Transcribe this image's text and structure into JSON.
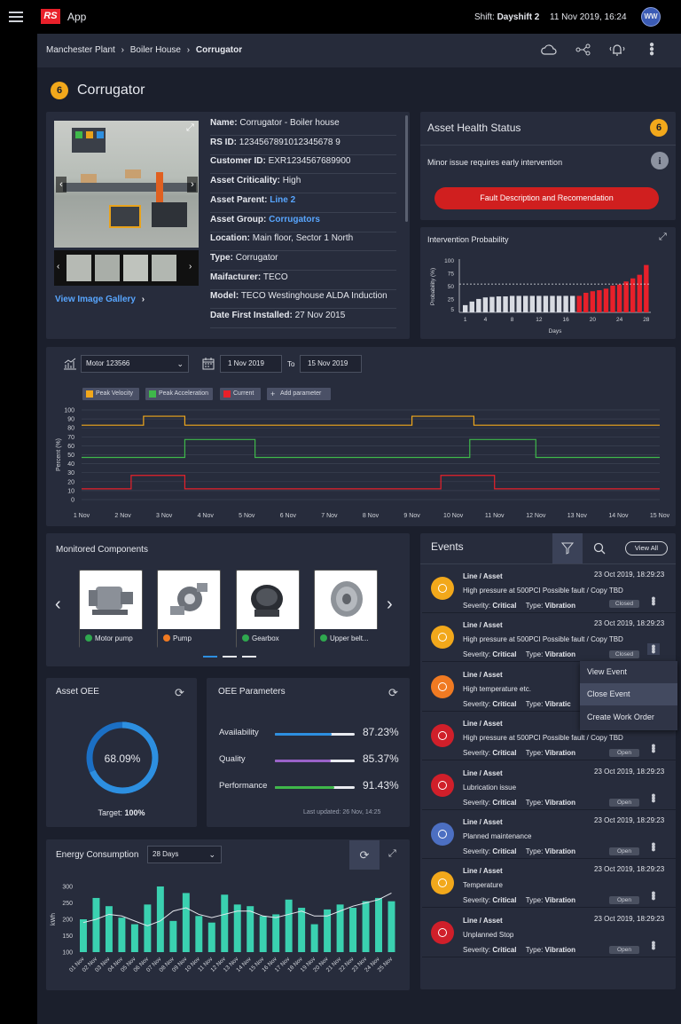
{
  "app": {
    "logo": "RS",
    "name": "App",
    "shift_label": "Shift:",
    "shift_value": "Dayshift 2",
    "datetime": "11 Nov 2019, 16:24",
    "user_initials": "WW"
  },
  "breadcrumb": {
    "items": [
      "Manchester Plant",
      "Boiler House"
    ],
    "current": "Corrugator"
  },
  "asset": {
    "badge": "6",
    "title": "Corrugator",
    "view_gallery": "View Image Gallery",
    "fields": [
      {
        "label": "Name:",
        "value": "Corrugator - Boiler house"
      },
      {
        "label": "RS ID:",
        "value": "1234567891012345678 9"
      },
      {
        "label": "Customer ID:",
        "value": "EXR1234567689900"
      },
      {
        "label": "Asset Criticality:",
        "value": "High"
      },
      {
        "label": "Asset Parent:",
        "value": "Line 2"
      },
      {
        "label": "Asset Group:",
        "value": "Corrugators"
      },
      {
        "label": "Location:",
        "value": "Main floor, Sector 1 North"
      },
      {
        "label": "Type:",
        "value": "Corrugator"
      },
      {
        "label": "Maifacturer:",
        "value": "TECO"
      },
      {
        "label": "Model:",
        "value": "TECO Westinghouse ALDA Induction"
      },
      {
        "label": "Date First Installed:",
        "value": "27 Nov 2015"
      }
    ]
  },
  "health": {
    "title": "Asset Health Status",
    "badge": "6",
    "message": "Minor issue requires early intervention",
    "button": "Fault Description and Recomendation"
  },
  "intervention": {
    "title": "Intervention Probability"
  },
  "motor": {
    "select": "Motor 123566",
    "date_from": "1 Nov 2019",
    "to_label": "To",
    "date_to": "15 Nov 2019",
    "params": [
      "Peak Velocity",
      "Peak Acceleration",
      "Current",
      "Add parameter"
    ]
  },
  "components": {
    "title": "Monitored Components",
    "items": [
      {
        "label": "Motor pump",
        "status": "#2fa84f"
      },
      {
        "label": "Pump",
        "status": "#f07a22"
      },
      {
        "label": "Gearbox",
        "status": "#2fa84f"
      },
      {
        "label": "Upper belt...",
        "status": "#2fa84f"
      }
    ]
  },
  "oee": {
    "title": "Asset OEE",
    "value": "68.09%",
    "value_num": 68.09,
    "target_label": "Target:",
    "target_value": "100%"
  },
  "oee_params": {
    "title": "OEE Parameters",
    "updated": "Last updated: 26 Nov, 14:25",
    "rows": [
      {
        "label": "Availability",
        "value": "87.23%",
        "num": 87.23,
        "color": "#2d8fe0"
      },
      {
        "label": "Quality",
        "value": "85.37%",
        "num": 85.37,
        "color": "#9a62c9"
      },
      {
        "label": "Performance",
        "value": "91.43%",
        "num": 91.43,
        "color": "#3fb84a"
      }
    ]
  },
  "energy": {
    "title": "Energy Consumption",
    "select": "28 Days"
  },
  "events": {
    "title": "Events",
    "view_all": "View All",
    "menu": [
      "View Event",
      "Close Event",
      "Create Work Order"
    ],
    "items": [
      {
        "heading": "Line / Asset",
        "date": "23 Oct 2019, 18:29:23",
        "desc": "High pressure at 500PCI Possible fault / Copy TBD",
        "sev_label": "Severity:",
        "sev": "Critical",
        "type_label": "Type:",
        "type": "Vibration",
        "status": "Closed",
        "icon": "valve-icon",
        "color": "#f2a81b"
      },
      {
        "heading": "Line / Asset",
        "date": "23 Oct 2019, 18:29:23",
        "desc": "High pressure at 500PCI Possible fault / Copy TBD",
        "sev_label": "Severity:",
        "sev": "Critical",
        "type_label": "Type:",
        "type": "Vibration",
        "status": "Closed",
        "icon": "valve-icon",
        "color": "#f2a81b"
      },
      {
        "heading": "Line / Asset",
        "date": "",
        "desc": "High temperature etc.",
        "sev_label": "Severity:",
        "sev": "Critical",
        "type_label": "Type:",
        "type": "Vibratic",
        "status": "",
        "icon": "thermometer-icon",
        "color": "#f07a22"
      },
      {
        "heading": "Line / Asset",
        "date": "",
        "desc": "High pressure at 500PCI Possible fault / Copy TBD",
        "sev_label": "Severity:",
        "sev": "Critical",
        "type_label": "Type:",
        "type": "Vibration",
        "status": "Open",
        "icon": "gauge-icon",
        "color": "#d01f2a"
      },
      {
        "heading": "Line / Asset",
        "date": "23 Oct 2019, 18:29:23",
        "desc": "Lubrication issue",
        "sev_label": "Severity:",
        "sev": "Critical",
        "type_label": "Type:",
        "type": "Vibration",
        "status": "Open",
        "icon": "test-tube-icon",
        "color": "#d01f2a"
      },
      {
        "heading": "Line / Asset",
        "date": "23 Oct 2019, 18:29:23",
        "desc": "Planned maintenance",
        "sev_label": "Severity:",
        "sev": "Critical",
        "type_label": "Type:",
        "type": "Vibration",
        "status": "Open",
        "icon": "tools-icon",
        "color": "#4c6fc2"
      },
      {
        "heading": "Line / Asset",
        "date": "23 Oct 2019, 18:29:23",
        "desc": "Temperature",
        "sev_label": "Severity:",
        "sev": "Critical",
        "type_label": "Type:",
        "type": "Vibration",
        "status": "Open",
        "icon": "thermometer-icon",
        "color": "#f2a81b"
      },
      {
        "heading": "Line / Asset",
        "date": "23 Oct 2019, 18:29:23",
        "desc": "Unplanned Stop",
        "sev_label": "Severity:",
        "sev": "Critical",
        "type_label": "Type:",
        "type": "Vibration",
        "status": "Open",
        "icon": "stop-icon",
        "color": "#d01f2a"
      }
    ]
  },
  "chart_data": [
    {
      "type": "bar",
      "title": "Intervention Probability",
      "ylabel": "Probability (%)",
      "xlabel": "Days",
      "ylim": [
        0,
        100
      ],
      "threshold": 55,
      "x_ticks": [
        "1",
        "4",
        "8",
        "12",
        "16",
        "20",
        "24",
        "28"
      ],
      "y_ticks": [
        "5",
        "25",
        "50",
        "75",
        "100"
      ],
      "x": [
        1,
        2,
        3,
        4,
        5,
        6,
        7,
        8,
        9,
        10,
        11,
        12,
        13,
        14,
        15,
        16,
        17,
        18,
        19,
        20,
        21,
        22,
        23,
        24,
        25,
        26,
        27,
        28
      ],
      "values": [
        14,
        21,
        26,
        29,
        30,
        31,
        31,
        32,
        32,
        32,
        32,
        32,
        32,
        32,
        32,
        32,
        32,
        32,
        38,
        41,
        43,
        46,
        52,
        54,
        60,
        66,
        73,
        92
      ],
      "colors": [
        "#d8dbe2",
        "#d8dbe2",
        "#d8dbe2",
        "#d8dbe2",
        "#d8dbe2",
        "#d8dbe2",
        "#d8dbe2",
        "#d8dbe2",
        "#d8dbe2",
        "#d8dbe2",
        "#d8dbe2",
        "#d8dbe2",
        "#d8dbe2",
        "#d8dbe2",
        "#d8dbe2",
        "#d8dbe2",
        "#d8dbe2",
        "#e8202a",
        "#e8202a",
        "#e8202a",
        "#e8202a",
        "#e8202a",
        "#e8202a",
        "#e8202a",
        "#e8202a",
        "#e8202a",
        "#e8202a",
        "#e8202a"
      ]
    },
    {
      "type": "line",
      "ylabel": "Percent (%)",
      "ylim": [
        0,
        100
      ],
      "y_ticks": [
        "0",
        "10",
        "20",
        "30",
        "40",
        "50",
        "60",
        "70",
        "80",
        "90",
        "100"
      ],
      "x_ticks": [
        "1 Nov",
        "2 Nov",
        "3 Nov",
        "4 Nov",
        "5 Nov",
        "6 Nov",
        "7 Nov",
        "8 Nov",
        "9 Nov",
        "10 Nov",
        "11 Nov",
        "12 Nov",
        "13 Nov",
        "14 Nov",
        "15 Nov"
      ],
      "series": [
        {
          "name": "Peak Velocity",
          "color": "#f2a81b",
          "steps": [
            [
              1,
              83
            ],
            [
              2.5,
              83
            ],
            [
              2.5,
              93
            ],
            [
              3.5,
              93
            ],
            [
              3.5,
              83
            ],
            [
              9,
              83
            ],
            [
              9,
              93
            ],
            [
              10.5,
              93
            ],
            [
              10.5,
              83
            ],
            [
              15,
              83
            ]
          ]
        },
        {
          "name": "Peak Acceleration",
          "color": "#3fb84a",
          "steps": [
            [
              1,
              47
            ],
            [
              3.5,
              47
            ],
            [
              3.5,
              67
            ],
            [
              5.2,
              67
            ],
            [
              5.2,
              47
            ],
            [
              10.4,
              47
            ],
            [
              10.4,
              67
            ],
            [
              12,
              67
            ],
            [
              12,
              47
            ],
            [
              15,
              47
            ]
          ]
        },
        {
          "name": "Current",
          "color": "#e8202a",
          "steps": [
            [
              1,
              12
            ],
            [
              2.2,
              12
            ],
            [
              2.2,
              27
            ],
            [
              3.5,
              27
            ],
            [
              3.5,
              12
            ],
            [
              9.7,
              12
            ],
            [
              9.7,
              27
            ],
            [
              11,
              27
            ],
            [
              11,
              12
            ],
            [
              15,
              12
            ]
          ]
        }
      ]
    },
    {
      "type": "bar",
      "title": "Energy Consumption",
      "ylabel": "kWh",
      "ylim": [
        100,
        300
      ],
      "y_ticks": [
        "100",
        "150",
        "200",
        "250",
        "300"
      ],
      "categories": [
        "01 Nov",
        "02 Nov",
        "03 Nov",
        "04 Nov",
        "05 Nov",
        "06 Nov",
        "07 Nov",
        "08 Nov",
        "09 Nov",
        "10 Nov",
        "11 Nov",
        "12 Nov",
        "13 Nov",
        "14 Nov",
        "15 Nov",
        "16 Nov",
        "17 Nov",
        "18 Nov",
        "19 Nov",
        "20 Nov",
        "21 Nov",
        "22 Nov",
        "23 Nov",
        "24 Nov",
        "25 Nov"
      ],
      "values": [
        200,
        265,
        240,
        205,
        185,
        245,
        300,
        195,
        280,
        210,
        190,
        275,
        245,
        240,
        210,
        215,
        260,
        235,
        185,
        230,
        245,
        235,
        255,
        265,
        255
      ],
      "trend": [
        190,
        200,
        215,
        210,
        195,
        180,
        195,
        225,
        235,
        215,
        205,
        215,
        225,
        225,
        210,
        205,
        215,
        225,
        210,
        210,
        225,
        240,
        250,
        260,
        280
      ]
    }
  ]
}
